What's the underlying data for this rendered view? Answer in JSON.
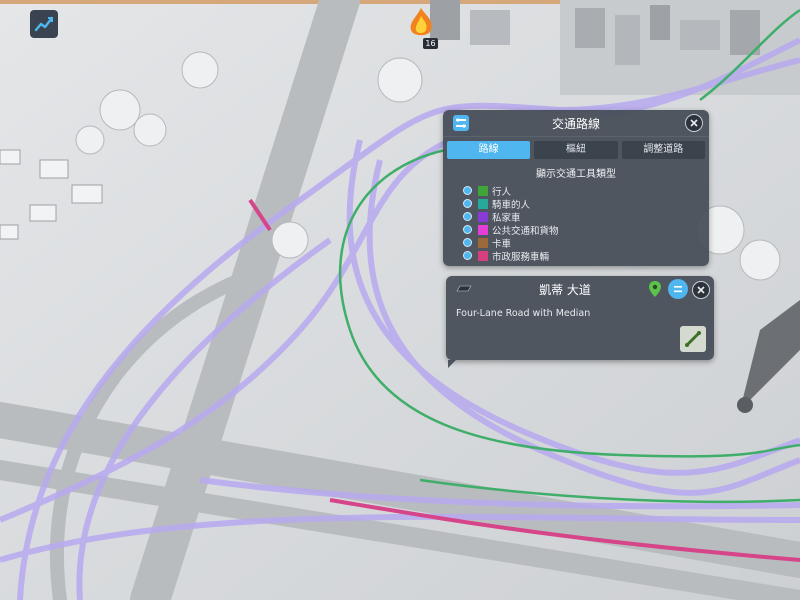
{
  "hud": {
    "fire_count": "16"
  },
  "routes_panel": {
    "title": "交通路線",
    "tabs": [
      {
        "label": "路線",
        "active": true
      },
      {
        "label": "樞紐",
        "active": false
      },
      {
        "label": "調整道路",
        "active": false
      }
    ],
    "legend_title": "顯示交通工具類型",
    "legend": [
      {
        "label": "行人",
        "color": "#3fa53a"
      },
      {
        "label": "騎車的人",
        "color": "#26a99a"
      },
      {
        "label": "私家車",
        "color": "#8a3bd6"
      },
      {
        "label": "公共交通和貨物",
        "color": "#e63fd8"
      },
      {
        "label": "卡車",
        "color": "#9a6a3a"
      },
      {
        "label": "市政服務車輛",
        "color": "#d53f7a"
      }
    ]
  },
  "road_panel": {
    "title": "凱蒂 大道",
    "road_type": "Four-Lane Road with Median"
  },
  "colors": {
    "panel_bg": "#464e58",
    "accent": "#4fb6f0",
    "car_route": "#b7a9f0",
    "pedestrian_route": "#3fae6a",
    "service_route": "#d6448a"
  }
}
